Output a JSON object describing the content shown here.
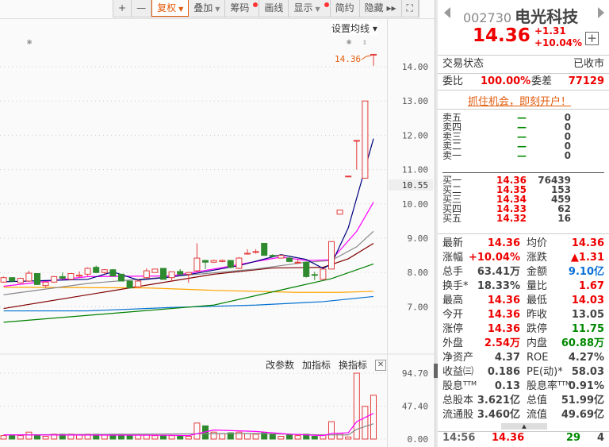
{
  "toolbar": {
    "items": [
      {
        "label": "+",
        "caret": false,
        "dot": false,
        "active": false
      },
      {
        "label": "—",
        "caret": false,
        "dot": false,
        "active": false
      },
      {
        "label": "复权",
        "caret": true,
        "dot": false,
        "active": true
      },
      {
        "label": "叠加",
        "caret": true,
        "dot": false,
        "active": false
      },
      {
        "label": "筹码",
        "caret": false,
        "dot": true,
        "active": false
      },
      {
        "label": "画线",
        "caret": false,
        "dot": false,
        "active": false
      },
      {
        "label": "显示",
        "caret": true,
        "dot": true,
        "active": false
      },
      {
        "label": "简约",
        "caret": false,
        "dot": false,
        "active": false
      },
      {
        "label": "隐藏 ▸▸",
        "caret": false,
        "dot": false,
        "active": false
      },
      {
        "label": "⛶",
        "caret": false,
        "dot": false,
        "active": false
      }
    ],
    "ma_settings": "设置均线 ▾"
  },
  "indicator_tools": {
    "edit": "改参数",
    "add": "加指标",
    "switch": "换指标",
    "close": "✕"
  },
  "colors": {
    "up": "#e43c3c",
    "down": "#2f8a2f",
    "ma5": "#000080",
    "ma10": "#ff00ff",
    "ma20": "#888888",
    "ma30": "#800000",
    "ma60": "#008000",
    "ma120": "#ffa500",
    "ma250": "#0070d0"
  },
  "chart_data": [
    {
      "type": "candlestick",
      "title": "K-line",
      "ylim": [
        6.6,
        14.6
      ],
      "yticks": [
        "14.00",
        "13.00",
        "12.00",
        "11.00",
        "10.00",
        "9.00",
        "8.00",
        "7.00"
      ],
      "cursor_price": "10.55",
      "last_price_label": "14.36",
      "ohlc": [
        [
          7.72,
          7.88,
          7.7,
          7.85
        ],
        [
          7.85,
          7.87,
          7.72,
          7.75
        ],
        [
          7.7,
          7.85,
          7.68,
          7.83
        ],
        [
          7.75,
          8.05,
          7.73,
          7.98
        ],
        [
          7.97,
          7.98,
          7.63,
          7.65
        ],
        [
          7.62,
          7.74,
          7.55,
          7.72
        ],
        [
          7.72,
          7.9,
          7.7,
          7.88
        ],
        [
          7.88,
          8.0,
          7.8,
          7.83
        ],
        [
          7.8,
          7.98,
          7.78,
          7.97
        ],
        [
          7.9,
          8.03,
          7.85,
          7.92
        ],
        [
          7.95,
          8.15,
          7.9,
          8.12
        ],
        [
          8.15,
          8.2,
          7.98,
          8.0
        ],
        [
          8.0,
          8.1,
          7.95,
          8.08
        ],
        [
          8.08,
          8.1,
          7.88,
          7.9
        ],
        [
          7.95,
          7.96,
          7.74,
          7.75
        ],
        [
          7.75,
          7.76,
          7.53,
          7.55
        ],
        [
          7.58,
          7.8,
          7.55,
          7.75
        ],
        [
          7.85,
          8.12,
          7.83,
          8.05
        ],
        [
          8.0,
          8.1,
          8.0,
          8.1
        ],
        [
          8.12,
          8.13,
          7.8,
          7.8
        ],
        [
          7.85,
          8.03,
          7.73,
          8.02
        ],
        [
          8.03,
          8.1,
          7.93,
          7.95
        ],
        [
          7.95,
          8.02,
          7.7,
          8.0
        ],
        [
          8.05,
          8.85,
          8.02,
          8.42
        ],
        [
          8.35,
          8.37,
          8.1,
          8.3
        ],
        [
          8.3,
          8.37,
          8.28,
          8.35
        ],
        [
          8.32,
          8.38,
          8.3,
          8.35
        ],
        [
          8.35,
          8.36,
          8.12,
          8.15
        ],
        [
          8.12,
          8.45,
          8.1,
          8.42
        ],
        [
          8.54,
          8.68,
          8.52,
          8.56
        ],
        [
          8.6,
          8.68,
          8.55,
          8.61
        ],
        [
          8.85,
          8.86,
          8.49,
          8.5
        ],
        [
          8.5,
          8.53,
          8.45,
          8.47
        ],
        [
          8.42,
          8.52,
          8.42,
          8.5
        ],
        [
          8.42,
          8.45,
          8.3,
          8.32
        ],
        [
          8.28,
          8.38,
          8.25,
          8.3
        ],
        [
          8.3,
          8.32,
          7.85,
          7.88
        ],
        [
          7.94,
          8.02,
          7.78,
          7.92
        ],
        [
          7.8,
          8.11,
          7.78,
          8.1
        ],
        [
          8.1,
          8.91,
          8.1,
          8.9
        ],
        [
          9.7,
          9.82,
          9.7,
          9.82
        ],
        [
          10.8,
          10.8,
          10.8,
          10.81
        ],
        [
          11.84,
          11.85,
          11.0,
          11.85
        ],
        [
          10.75,
          13.0,
          10.75,
          13.0
        ],
        [
          14.35,
          14.36,
          14.03,
          14.36
        ]
      ],
      "ma_lines": {
        "ma5": [
          [
            0,
            7.73
          ],
          [
            3,
            7.75
          ],
          [
            10,
            7.8
          ],
          [
            13,
            8.02
          ],
          [
            16,
            7.78
          ],
          [
            20,
            7.87
          ],
          [
            23,
            7.98
          ],
          [
            28,
            8.2
          ],
          [
            33,
            8.52
          ],
          [
            36,
            8.38
          ],
          [
            38,
            8.12
          ],
          [
            39,
            8.25
          ],
          [
            41,
            9.3
          ],
          [
            44,
            11.9
          ]
        ],
        "ma10": [
          [
            0,
            7.6
          ],
          [
            10,
            7.88
          ],
          [
            20,
            7.9
          ],
          [
            25,
            8.1
          ],
          [
            30,
            8.32
          ],
          [
            33,
            8.45
          ],
          [
            36,
            8.35
          ],
          [
            39,
            8.37
          ],
          [
            42,
            9.2
          ],
          [
            44,
            10.05
          ]
        ],
        "ma20": [
          [
            0,
            7.35
          ],
          [
            10,
            7.68
          ],
          [
            20,
            7.88
          ],
          [
            30,
            8.1
          ],
          [
            36,
            8.3
          ],
          [
            39,
            8.35
          ],
          [
            42,
            8.75
          ],
          [
            44,
            9.2
          ]
        ],
        "ma30": [
          [
            0,
            6.95
          ],
          [
            15,
            7.55
          ],
          [
            25,
            7.95
          ],
          [
            32,
            8.13
          ],
          [
            38,
            8.15
          ],
          [
            41,
            8.4
          ],
          [
            44,
            8.85
          ]
        ],
        "ma60": [
          [
            0,
            6.55
          ],
          [
            15,
            6.85
          ],
          [
            25,
            7.05
          ],
          [
            35,
            7.6
          ],
          [
            39,
            7.82
          ],
          [
            44,
            8.25
          ]
        ],
        "ma120": [
          [
            0,
            7.57
          ],
          [
            17,
            7.55
          ],
          [
            25,
            7.48
          ],
          [
            35,
            7.42
          ],
          [
            40,
            7.42
          ],
          [
            44,
            7.45
          ]
        ],
        "ma250": [
          [
            0,
            6.88
          ],
          [
            10,
            6.88
          ],
          [
            20,
            6.98
          ],
          [
            30,
            7.05
          ],
          [
            38,
            7.15
          ],
          [
            44,
            7.3
          ]
        ]
      }
    },
    {
      "type": "bar",
      "title": "Volume",
      "ylim": [
        0,
        94.7
      ],
      "yticks": [
        "94.70",
        "47.40",
        "0.00"
      ],
      "values": [
        5,
        6,
        5,
        10,
        6,
        4,
        7,
        7,
        7,
        6,
        7,
        7,
        6,
        7,
        7,
        5,
        6,
        6,
        5,
        5,
        5,
        5,
        4,
        23,
        19,
        10,
        8,
        9,
        10,
        8,
        7,
        9,
        7,
        4,
        6,
        5,
        7,
        4,
        6,
        25,
        8,
        3,
        94.7,
        47,
        63
      ],
      "ma_lines": {
        "vma5": [
          [
            0,
            6
          ],
          [
            20,
            5.5
          ],
          [
            22,
            5
          ],
          [
            25,
            13
          ],
          [
            30,
            11
          ],
          [
            34,
            7
          ],
          [
            38,
            5
          ],
          [
            39,
            8
          ],
          [
            41,
            9
          ],
          [
            42,
            25
          ],
          [
            44,
            37
          ]
        ],
        "vma10": [
          [
            0,
            6
          ],
          [
            30,
            8
          ],
          [
            34,
            7
          ],
          [
            38,
            6
          ],
          [
            41,
            6
          ],
          [
            42,
            14
          ],
          [
            44,
            22
          ]
        ]
      }
    }
  ],
  "quote": {
    "code": "002730",
    "name": "电光科技",
    "price": "14.36",
    "change": "+1.31",
    "change_pct": "+10.04%",
    "status_label": "交易状态",
    "status": "已收市",
    "wb_label": "委比",
    "wb": "100.00%",
    "wc_label": "委差",
    "wc": "77129",
    "promo": "抓住机会，即刻开户！"
  },
  "orderbook": {
    "asks": [
      {
        "label": "卖五",
        "price": "—",
        "vol": "0"
      },
      {
        "label": "卖四",
        "price": "—",
        "vol": "0"
      },
      {
        "label": "卖三",
        "price": "—",
        "vol": "0"
      },
      {
        "label": "卖二",
        "price": "—",
        "vol": "0"
      },
      {
        "label": "卖一",
        "price": "—",
        "vol": "0"
      }
    ],
    "bids": [
      {
        "label": "买一",
        "price": "14.36",
        "vol": "76439"
      },
      {
        "label": "买二",
        "price": "14.35",
        "vol": "153"
      },
      {
        "label": "买三",
        "price": "14.34",
        "vol": "459"
      },
      {
        "label": "买四",
        "price": "14.33",
        "vol": "62"
      },
      {
        "label": "买五",
        "price": "14.32",
        "vol": "16"
      }
    ]
  },
  "stats": [
    [
      "最新",
      "14.36",
      "red",
      "均价",
      "14.36",
      "red"
    ],
    [
      "涨幅",
      "+10.04%",
      "red",
      "涨跌",
      "▲1.31",
      "red"
    ],
    [
      "总手",
      "63.41万",
      "gray",
      "金额",
      "9.10亿",
      "blue"
    ],
    [
      "换手*",
      "18.33%",
      "gray",
      "量比",
      "1.67",
      "red"
    ],
    [
      "最高",
      "14.36",
      "red",
      "最低",
      "14.03",
      "red"
    ],
    [
      "今开",
      "14.36",
      "red",
      "昨收",
      "13.05",
      "gray"
    ],
    [
      "涨停",
      "14.36",
      "red",
      "跌停",
      "11.75",
      "green"
    ],
    [
      "外盘",
      "2.54万",
      "red",
      "内盘",
      "60.88万",
      "green"
    ],
    [
      "净资产",
      "4.37",
      "gray",
      "ROE",
      "4.27%",
      "gray"
    ],
    [
      "收益㈢",
      "0.186",
      "gray",
      "PE(动)*",
      "58.03",
      "gray"
    ],
    [
      "股息ᵀᵀᴹ",
      "0.13",
      "gray",
      "股息率ᵀᵀᴹ",
      "0.91%",
      "gray"
    ],
    [
      "总股本",
      "3.621亿",
      "gray",
      "总值",
      "51.99亿",
      "gray"
    ],
    [
      "流通股",
      "3.460亿",
      "gray",
      "流值",
      "49.69亿",
      "gray"
    ]
  ],
  "tick": {
    "time": "14:56",
    "price": "14.36",
    "vol": "29",
    "count": "4"
  }
}
